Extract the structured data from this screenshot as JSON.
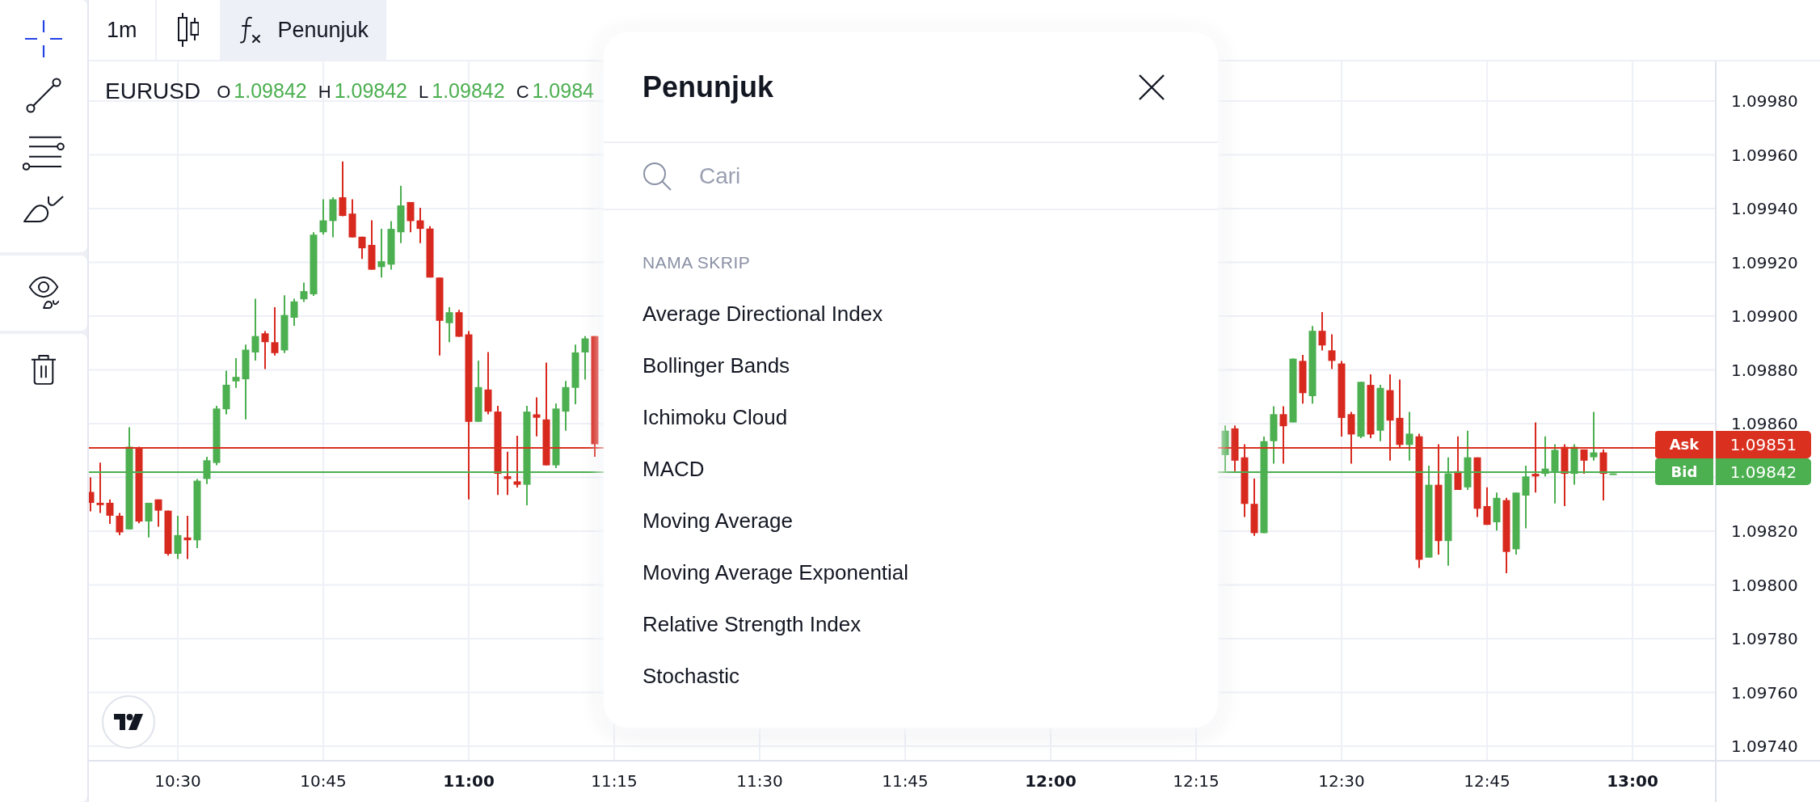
{
  "drawing_tools": [
    [
      {
        "selected": true
      },
      {
        "selected": false
      },
      {
        "selected": false
      },
      {
        "selected": false
      }
    ],
    [
      {
        "selected": false
      }
    ],
    [
      {
        "selected": false
      }
    ]
  ],
  "toolbar": {
    "interval": {
      "label": "1m",
      "active": false
    },
    "chart_type": {
      "active": false
    },
    "indicators": {
      "label": "Penunjuk",
      "active": true
    }
  },
  "legend": {
    "symbol": "EURUSD",
    "values": [
      {
        "label": "O",
        "value": "1.09842"
      },
      {
        "label": "H",
        "value": "1.09842"
      },
      {
        "label": "L",
        "value": "1.09842"
      },
      {
        "label": "C",
        "value": "1.0984"
      }
    ]
  },
  "price_axis": {
    "labels_above_quotes": [
      "1.09980",
      "1.09960",
      "1.09940",
      "1.09920",
      "1.09900",
      "1.09880",
      "1.09860"
    ],
    "labels_below_quotes": [
      "1.09820",
      "1.09800",
      "1.09780",
      "1.09760",
      "1.09740"
    ]
  },
  "quotes": [
    {
      "label": "Ask",
      "price": "1.09851",
      "color": "#d9301f"
    },
    {
      "label": "Bid",
      "price": "1.09842",
      "color": "#4caf50"
    }
  ],
  "time_axis": {
    "labels": [
      {
        "label": "10:30",
        "major": false
      },
      {
        "label": "10:45",
        "major": false
      },
      {
        "label": "11:00",
        "major": true
      },
      {
        "label": "11:15",
        "major": false
      },
      {
        "label": "11:30",
        "major": false
      },
      {
        "label": "11:45",
        "major": false
      },
      {
        "label": "12:00",
        "major": true
      },
      {
        "label": "12:15",
        "major": false
      },
      {
        "label": "12:30",
        "major": false
      },
      {
        "label": "12:45",
        "major": false
      },
      {
        "label": "13:00",
        "major": true
      }
    ]
  },
  "indicator_dialog": {
    "title": "Penunjuk",
    "search": {
      "placeholder": "Cari"
    },
    "section_title": "NAMA SKRIP",
    "items": [
      "Average Directional Index",
      "Bollinger Bands",
      "Ichimoku Cloud",
      "MACD",
      "Moving Average",
      "Moving Average Exponential",
      "Relative Strength Index",
      "Stochastic"
    ]
  }
}
